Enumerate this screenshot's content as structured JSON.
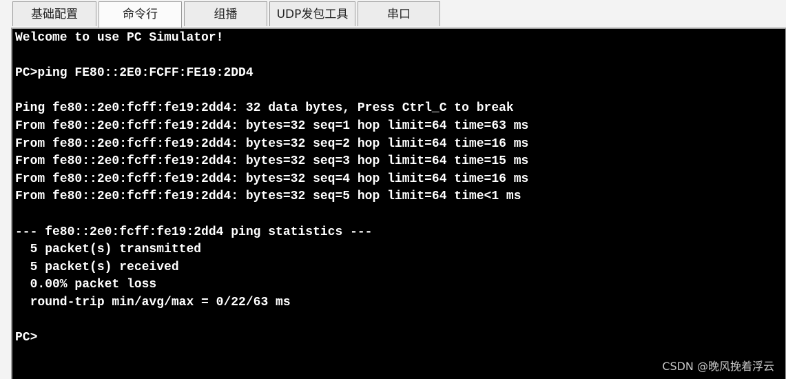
{
  "tabs": [
    {
      "label": "基础配置",
      "width": 122
    },
    {
      "label": "命令行",
      "width": 121
    },
    {
      "label": "组播",
      "width": 121
    },
    {
      "label": "UDP发包工具",
      "width": 125
    },
    {
      "label": "串口",
      "width": 120
    }
  ],
  "active_tab": 1,
  "terminal": {
    "lines": [
      "Welcome to use PC Simulator!",
      "",
      "PC>ping FE80::2E0:FCFF:FE19:2DD4",
      "",
      "Ping fe80::2e0:fcff:fe19:2dd4: 32 data bytes, Press Ctrl_C to break",
      "From fe80::2e0:fcff:fe19:2dd4: bytes=32 seq=1 hop limit=64 time=63 ms",
      "From fe80::2e0:fcff:fe19:2dd4: bytes=32 seq=2 hop limit=64 time=16 ms",
      "From fe80::2e0:fcff:fe19:2dd4: bytes=32 seq=3 hop limit=64 time=15 ms",
      "From fe80::2e0:fcff:fe19:2dd4: bytes=32 seq=4 hop limit=64 time=16 ms",
      "From fe80::2e0:fcff:fe19:2dd4: bytes=32 seq=5 hop limit=64 time<1 ms",
      "",
      "--- fe80::2e0:fcff:fe19:2dd4 ping statistics ---",
      "  5 packet(s) transmitted",
      "  5 packet(s) received",
      "  0.00% packet loss",
      "  round-trip min/avg/max = 0/22/63 ms",
      "",
      "PC>"
    ]
  },
  "watermark": "CSDN @晚风挽着浮云",
  "colors": {
    "terminal_bg": "#000000",
    "terminal_fg": "#ffffff",
    "tab_bg": "#ececec",
    "tab_active_bg": "#fbfbfb",
    "border": "#9a9a9a"
  }
}
